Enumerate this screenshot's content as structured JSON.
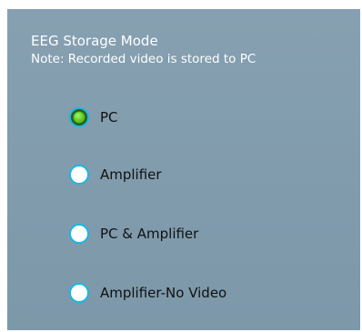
{
  "storage_mode": {
    "title": "EEG Storage Mode",
    "note": "Note: Recorded video is stored to PC",
    "selected_index": 0,
    "options": [
      {
        "label": "PC",
        "selected": true
      },
      {
        "label": "Amplifier",
        "selected": false
      },
      {
        "label": "PC & Amplifier",
        "selected": false
      },
      {
        "label": "Amplifier-No Video",
        "selected": false
      }
    ]
  },
  "colors": {
    "panel_background": "#7f9aab",
    "radio_border": "#19b7e6",
    "radio_selected_fill": "#67d22a",
    "title_text": "#ffffff",
    "option_text": "#111111"
  }
}
